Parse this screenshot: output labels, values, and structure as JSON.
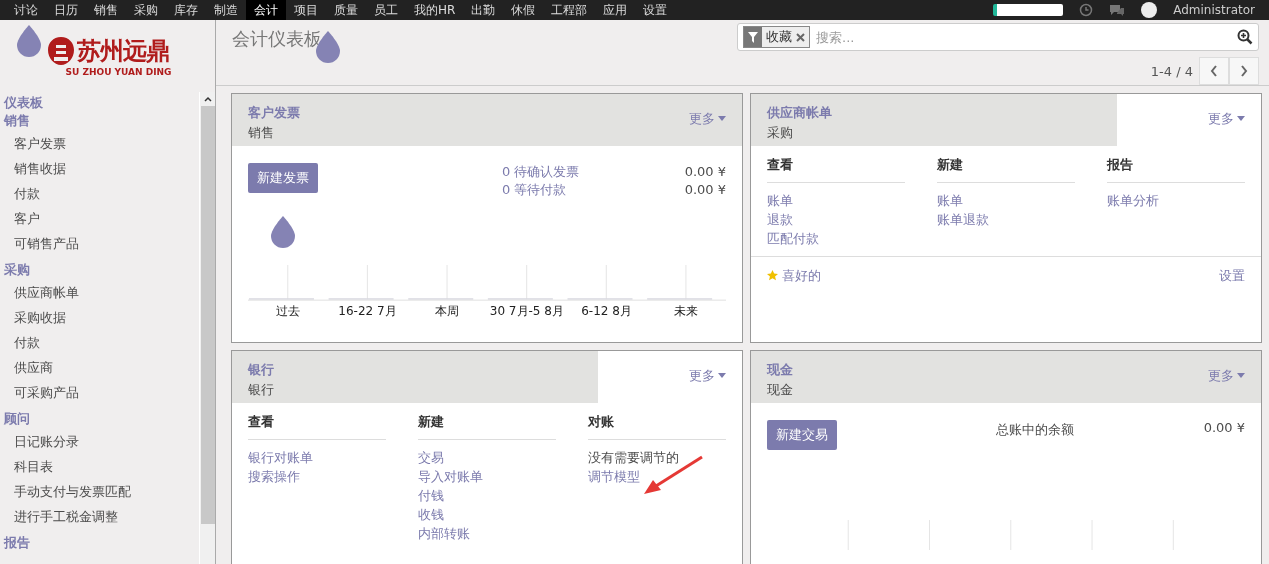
{
  "top_menu": [
    {
      "label": "讨论",
      "selected": false
    },
    {
      "label": "日历",
      "selected": false
    },
    {
      "label": "销售",
      "selected": false
    },
    {
      "label": "采购",
      "selected": false
    },
    {
      "label": "库存",
      "selected": false
    },
    {
      "label": "制造",
      "selected": false
    },
    {
      "label": "会计",
      "selected": true
    },
    {
      "label": "项目",
      "selected": false
    },
    {
      "label": "质量",
      "selected": false
    },
    {
      "label": "员工",
      "selected": false
    },
    {
      "label": "我的HR",
      "selected": false
    },
    {
      "label": "出勤",
      "selected": false
    },
    {
      "label": "休假",
      "selected": false
    },
    {
      "label": "工程部",
      "selected": false
    },
    {
      "label": "应用",
      "selected": false
    },
    {
      "label": "设置",
      "selected": false
    }
  ],
  "user": "Administrator",
  "logo": {
    "name": "苏州远鼎",
    "subtitle": "SU ZHOU YUAN DING"
  },
  "sidebar": [
    {
      "heading": "仪表板"
    },
    {
      "heading": "销售",
      "items": [
        "客户发票",
        "销售收据",
        "付款",
        "客户",
        "可销售产品"
      ]
    },
    {
      "heading": "采购",
      "items": [
        "供应商帐单",
        "采购收据",
        "付款",
        "供应商",
        "可采购产品"
      ]
    },
    {
      "heading": "顾问",
      "items": [
        "日记账分录",
        "科目表",
        "手动支付与发票匹配",
        "进行手工税金调整"
      ]
    },
    {
      "heading": "报告"
    }
  ],
  "page_title": "会计仪表板",
  "search": {
    "facet": "收藏",
    "placeholder": "搜索..."
  },
  "pager": "1-4 / 4",
  "cards": [
    {
      "kind": "invoice",
      "title": "客户发票",
      "subtitle": "销售",
      "header_full_width": true,
      "more": "更多",
      "button": "新建发票",
      "stats": [
        {
          "label": "0 待确认发票",
          "amount": "0.00 ¥"
        },
        {
          "label": "0 等待付款",
          "amount": "0.00 ¥"
        }
      ],
      "chart_labels": [
        "过去",
        "16-22 7月",
        "本周",
        "30 7月-5 8月",
        "6-12 8月",
        "未来"
      ]
    },
    {
      "kind": "sections",
      "title": "供应商帐单",
      "subtitle": "采购",
      "header_full_width": false,
      "more": "更多",
      "sections": [
        {
          "heading": "查看",
          "links": [
            {
              "text": "账单",
              "link": true
            },
            {
              "text": "退款",
              "link": true
            },
            {
              "text": "匹配付款",
              "link": true
            }
          ]
        },
        {
          "heading": "新建",
          "links": [
            {
              "text": "账单",
              "link": true
            },
            {
              "text": "账单退款",
              "link": true
            }
          ]
        },
        {
          "heading": "报告",
          "links": [
            {
              "text": "账单分析",
              "link": true
            }
          ]
        }
      ],
      "footer": {
        "favorite": "喜好的",
        "settings": "设置"
      }
    },
    {
      "kind": "sections",
      "title": "银行",
      "subtitle": "银行",
      "header_full_width": false,
      "more": "更多",
      "sections": [
        {
          "heading": "查看",
          "links": [
            {
              "text": "银行对账单",
              "link": true
            },
            {
              "text": "搜索操作",
              "link": true
            }
          ]
        },
        {
          "heading": "新建",
          "links": [
            {
              "text": "交易",
              "link": true
            },
            {
              "text": "导入对账单",
              "link": true
            },
            {
              "text": "付钱",
              "link": true
            },
            {
              "text": "收钱",
              "link": true
            },
            {
              "text": "内部转账",
              "link": true
            }
          ]
        },
        {
          "heading": "对账",
          "links": [
            {
              "text": "没有需要调节的",
              "link": false
            },
            {
              "text": "调节模型",
              "link": true
            }
          ]
        }
      ]
    },
    {
      "kind": "cash",
      "title": "现金",
      "subtitle": "现金",
      "header_full_width": true,
      "more": "更多",
      "button": "新建交易",
      "balance_label": "总账中的余额",
      "balance": "0.00 ¥"
    }
  ]
}
